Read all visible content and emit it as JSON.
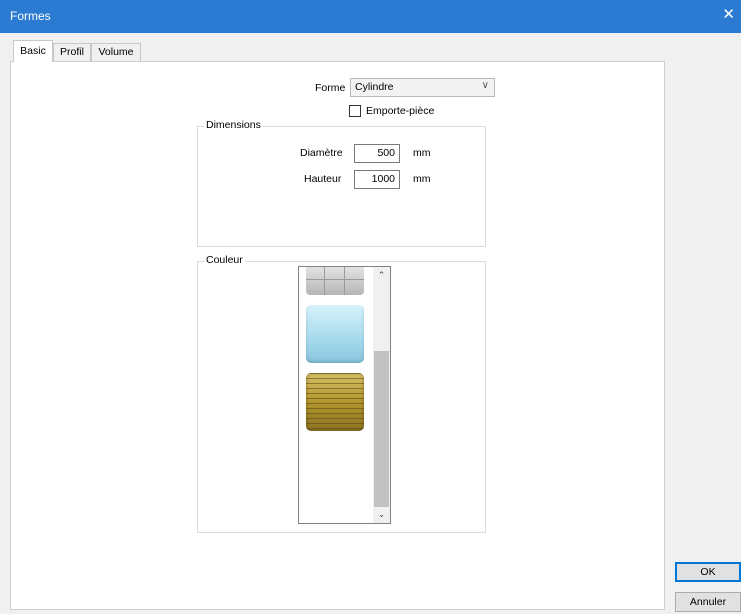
{
  "window": {
    "title": "Formes",
    "close": "✕"
  },
  "tabs": [
    {
      "label": "Basic",
      "active": true
    },
    {
      "label": "Profil",
      "active": false
    },
    {
      "label": "Volume",
      "active": false
    }
  ],
  "forme": {
    "label": "Forme",
    "selected": "Cylindre",
    "emporte_piece": {
      "label": "Emporte-pièce",
      "checked": false
    }
  },
  "dimensions": {
    "title": "Dimensions",
    "diametre": {
      "label": "Diamètre",
      "value": "500",
      "unit": "mm"
    },
    "hauteur": {
      "label": "Hauteur",
      "value": "1000",
      "unit": "mm"
    }
  },
  "couleur": {
    "title": "Couleur",
    "swatches": [
      {
        "name": "gray-tile",
        "color": "#c8c8c8"
      },
      {
        "name": "light-blue",
        "color": "#a9dbee"
      },
      {
        "name": "yellow-brick",
        "color": "#b3962e"
      }
    ],
    "scroll_up": "⌃",
    "scroll_down": "⌄"
  },
  "buttons": {
    "ok": "OK",
    "annuler": "Annuler"
  }
}
